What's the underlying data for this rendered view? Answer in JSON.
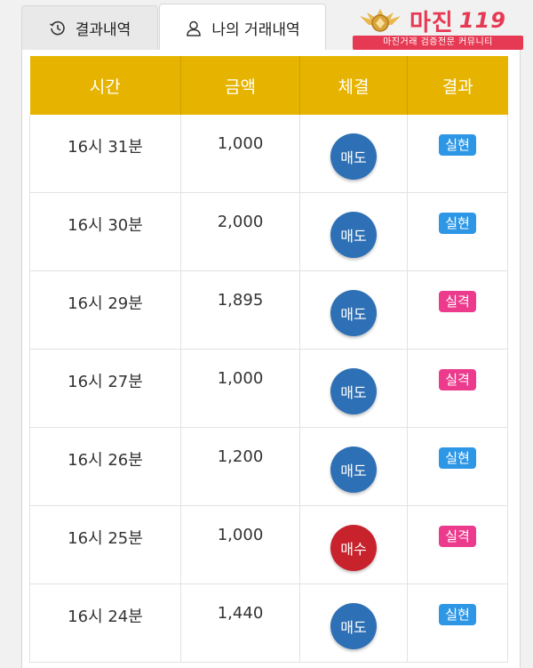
{
  "tabs": {
    "results_label": "결과내역",
    "results_icon": "history-icon",
    "mine_label": "나의 거래내역",
    "mine_icon": "user-icon"
  },
  "logo": {
    "name": "마진",
    "number": "119",
    "tagline": "마진거래 검증전문 커뮤니티",
    "brand_color": "#e63a54"
  },
  "table": {
    "headers": [
      "시간",
      "금액",
      "체결",
      "결과"
    ],
    "header_color": "#e6b400",
    "rows": [
      {
        "time": "16시 31분",
        "amount": "1,000",
        "type": "매도",
        "result": "실현"
      },
      {
        "time": "16시 30분",
        "amount": "2,000",
        "type": "매도",
        "result": "실현"
      },
      {
        "time": "16시 29분",
        "amount": "1,895",
        "type": "매도",
        "result": "실격"
      },
      {
        "time": "16시 27분",
        "amount": "1,000",
        "type": "매도",
        "result": "실격"
      },
      {
        "time": "16시 26분",
        "amount": "1,200",
        "type": "매도",
        "result": "실현"
      },
      {
        "time": "16시 25분",
        "amount": "1,000",
        "type": "매수",
        "result": "실격"
      },
      {
        "time": "16시 24분",
        "amount": "1,440",
        "type": "매도",
        "result": "실현"
      }
    ]
  },
  "colors": {
    "sell": "#2e70b5",
    "buy": "#c8222d",
    "hit": "#2d97e6",
    "miss": "#ec3a8c"
  }
}
